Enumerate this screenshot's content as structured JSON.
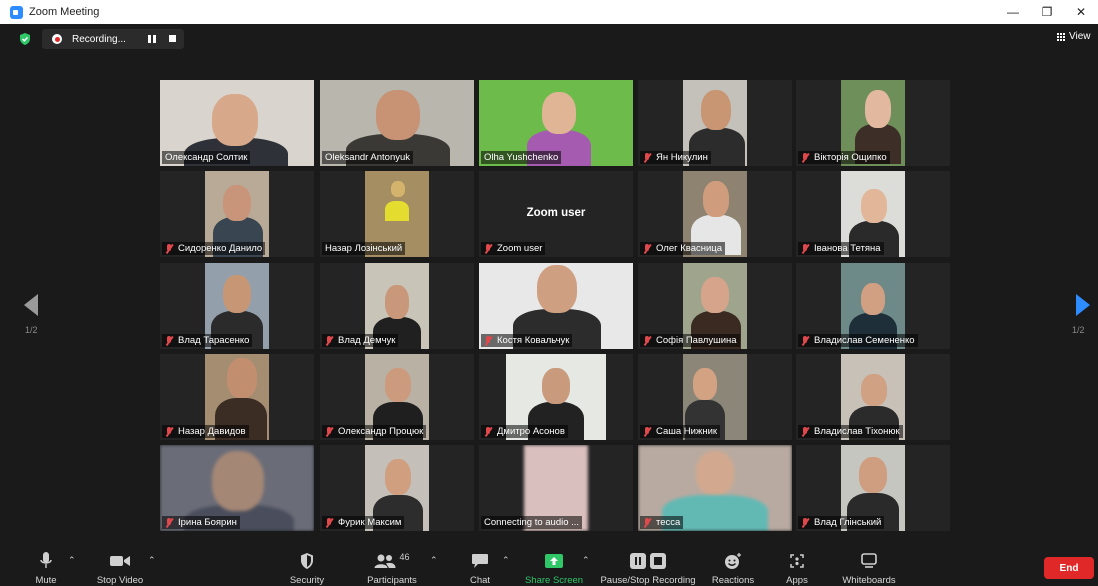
{
  "window": {
    "title": "Zoom Meeting"
  },
  "recording": {
    "label": "Recording..."
  },
  "view": {
    "label": "View"
  },
  "pagination": {
    "left": "1/2",
    "right": "1/2"
  },
  "tiles": [
    {
      "name": "Олександр Солтик",
      "muted": false,
      "active": true,
      "kind": "video"
    },
    {
      "name": "Oleksandr Antonyuk",
      "muted": false,
      "kind": "video"
    },
    {
      "name": "Olha Yushchenko",
      "muted": false,
      "kind": "video"
    },
    {
      "name": "Ян Никулин",
      "muted": true,
      "kind": "video"
    },
    {
      "name": "Вікторія Ощипко",
      "muted": true,
      "kind": "video"
    },
    {
      "name": "Сидоренко Данило",
      "muted": true,
      "kind": "video"
    },
    {
      "name": "Назар Лозінський",
      "muted": false,
      "kind": "video"
    },
    {
      "name": "Zoom user",
      "muted": true,
      "kind": "text",
      "big_label": "Zoom user"
    },
    {
      "name": "Олег Квасница",
      "muted": true,
      "kind": "video"
    },
    {
      "name": "Іванова Тетяна",
      "muted": true,
      "kind": "video"
    },
    {
      "name": "Влад Тарасенко",
      "muted": true,
      "kind": "video"
    },
    {
      "name": "Влад Демчук",
      "muted": true,
      "kind": "video"
    },
    {
      "name": "Костя Ковальчук",
      "muted": true,
      "kind": "video"
    },
    {
      "name": "Софія Павлушина",
      "muted": true,
      "kind": "video"
    },
    {
      "name": "Владислав Семененко",
      "muted": true,
      "kind": "video"
    },
    {
      "name": "Назар Давидов",
      "muted": true,
      "kind": "video"
    },
    {
      "name": "Олександр Процюк",
      "muted": true,
      "kind": "video"
    },
    {
      "name": "Дмитро Асонов",
      "muted": true,
      "kind": "video"
    },
    {
      "name": "Саша Нижник",
      "muted": true,
      "kind": "video"
    },
    {
      "name": "Владислав Тіхонюк",
      "muted": true,
      "kind": "video"
    },
    {
      "name": "Ірина Боярин",
      "muted": true,
      "kind": "video"
    },
    {
      "name": "Фурик Максим",
      "muted": true,
      "kind": "video"
    },
    {
      "name": "Connecting to audio ...",
      "muted": false,
      "kind": "video"
    },
    {
      "name": "тесса",
      "muted": true,
      "kind": "video"
    },
    {
      "name": "Влад Глінський",
      "muted": true,
      "kind": "video"
    }
  ],
  "toolbar": {
    "mute": "Mute",
    "stop_video": "Stop Video",
    "security": "Security",
    "participants": "Participants",
    "participants_count": "46",
    "chat": "Chat",
    "share_screen": "Share Screen",
    "pause_stop_recording": "Pause/Stop Recording",
    "reactions": "Reactions",
    "apps": "Apps",
    "whiteboards": "Whiteboards",
    "end": "End"
  },
  "colors": {
    "accent": "#2d8cff",
    "active_speaker": "#c8e35a",
    "share_green": "#2fc768",
    "end_red": "#e02828",
    "mute_red": "#e0484c"
  }
}
